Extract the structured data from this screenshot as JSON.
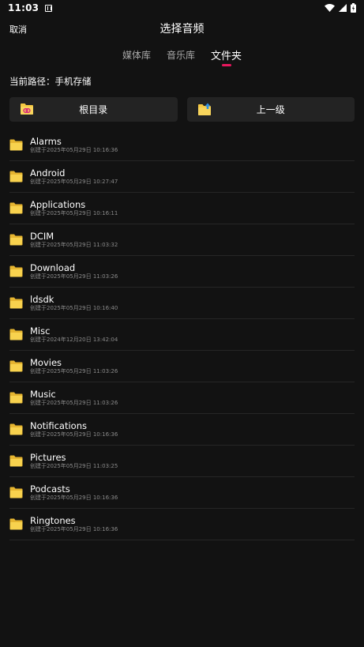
{
  "status_bar": {
    "time": "11:03"
  },
  "header": {
    "cancel_label": "取消",
    "title": "选择音频"
  },
  "tabs": [
    {
      "label": "媒体库",
      "active": false
    },
    {
      "label": "音乐库",
      "active": false
    },
    {
      "label": "文件夹",
      "active": true
    }
  ],
  "path": {
    "label": "当前路径：",
    "value": "手机存储"
  },
  "actions": {
    "root_label": "根目录",
    "up_label": "上一级"
  },
  "colors": {
    "accent": "#e8175d",
    "folder": "#f5c842",
    "background": "#121212",
    "button": "#232323"
  },
  "folders": [
    {
      "name": "Alarms",
      "meta": "创建于2025年05月29日 10:16:36"
    },
    {
      "name": "Android",
      "meta": "创建于2025年05月29日 10:27:47"
    },
    {
      "name": "Applications",
      "meta": "创建于2025年05月29日 10:16:11"
    },
    {
      "name": "DCIM",
      "meta": "创建于2025年05月29日 11:03:32"
    },
    {
      "name": "Download",
      "meta": "创建于2025年05月29日 11:03:26"
    },
    {
      "name": "ldsdk",
      "meta": "创建于2025年05月29日 10:16:40"
    },
    {
      "name": "Misc",
      "meta": "创建于2024年12月20日 13:42:04"
    },
    {
      "name": "Movies",
      "meta": "创建于2025年05月29日 11:03:26"
    },
    {
      "name": "Music",
      "meta": "创建于2025年05月29日 11:03:26"
    },
    {
      "name": "Notifications",
      "meta": "创建于2025年05月29日 10:16:36"
    },
    {
      "name": "Pictures",
      "meta": "创建于2025年05月29日 11:03:25"
    },
    {
      "name": "Podcasts",
      "meta": "创建于2025年05月29日 10:16:36"
    },
    {
      "name": "Ringtones",
      "meta": "创建于2025年05月29日 10:16:36"
    }
  ]
}
